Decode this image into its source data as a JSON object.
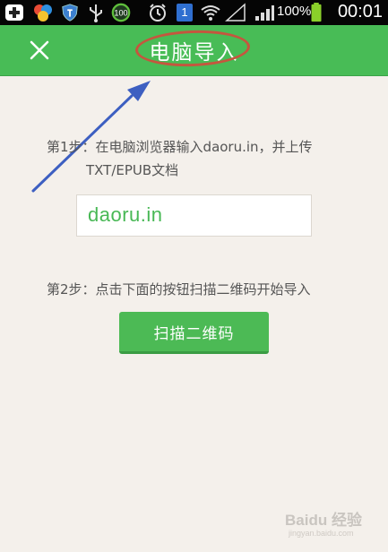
{
  "status_bar": {
    "battery_percent": "100%",
    "time": "00:01",
    "badge_count": "1",
    "ring_value": "100"
  },
  "header": {
    "title": "电脑导入"
  },
  "steps": {
    "step1_line1": "第1步：在电脑浏览器输入daoru.in，并上传",
    "step1_line2": "TXT/EPUB文档",
    "url": "daoru.in",
    "step2": "第2步：点击下面的按钮扫描二维码开始导入",
    "scan_button": "扫描二维码"
  },
  "watermark": {
    "brand": "Baidu 经验",
    "url": "jingyan.baidu.com"
  },
  "colors": {
    "header_green": "#48bc56",
    "button_green": "#4cba55",
    "annotation_red": "#c5563e",
    "annotation_arrow": "#3d5fc1"
  }
}
